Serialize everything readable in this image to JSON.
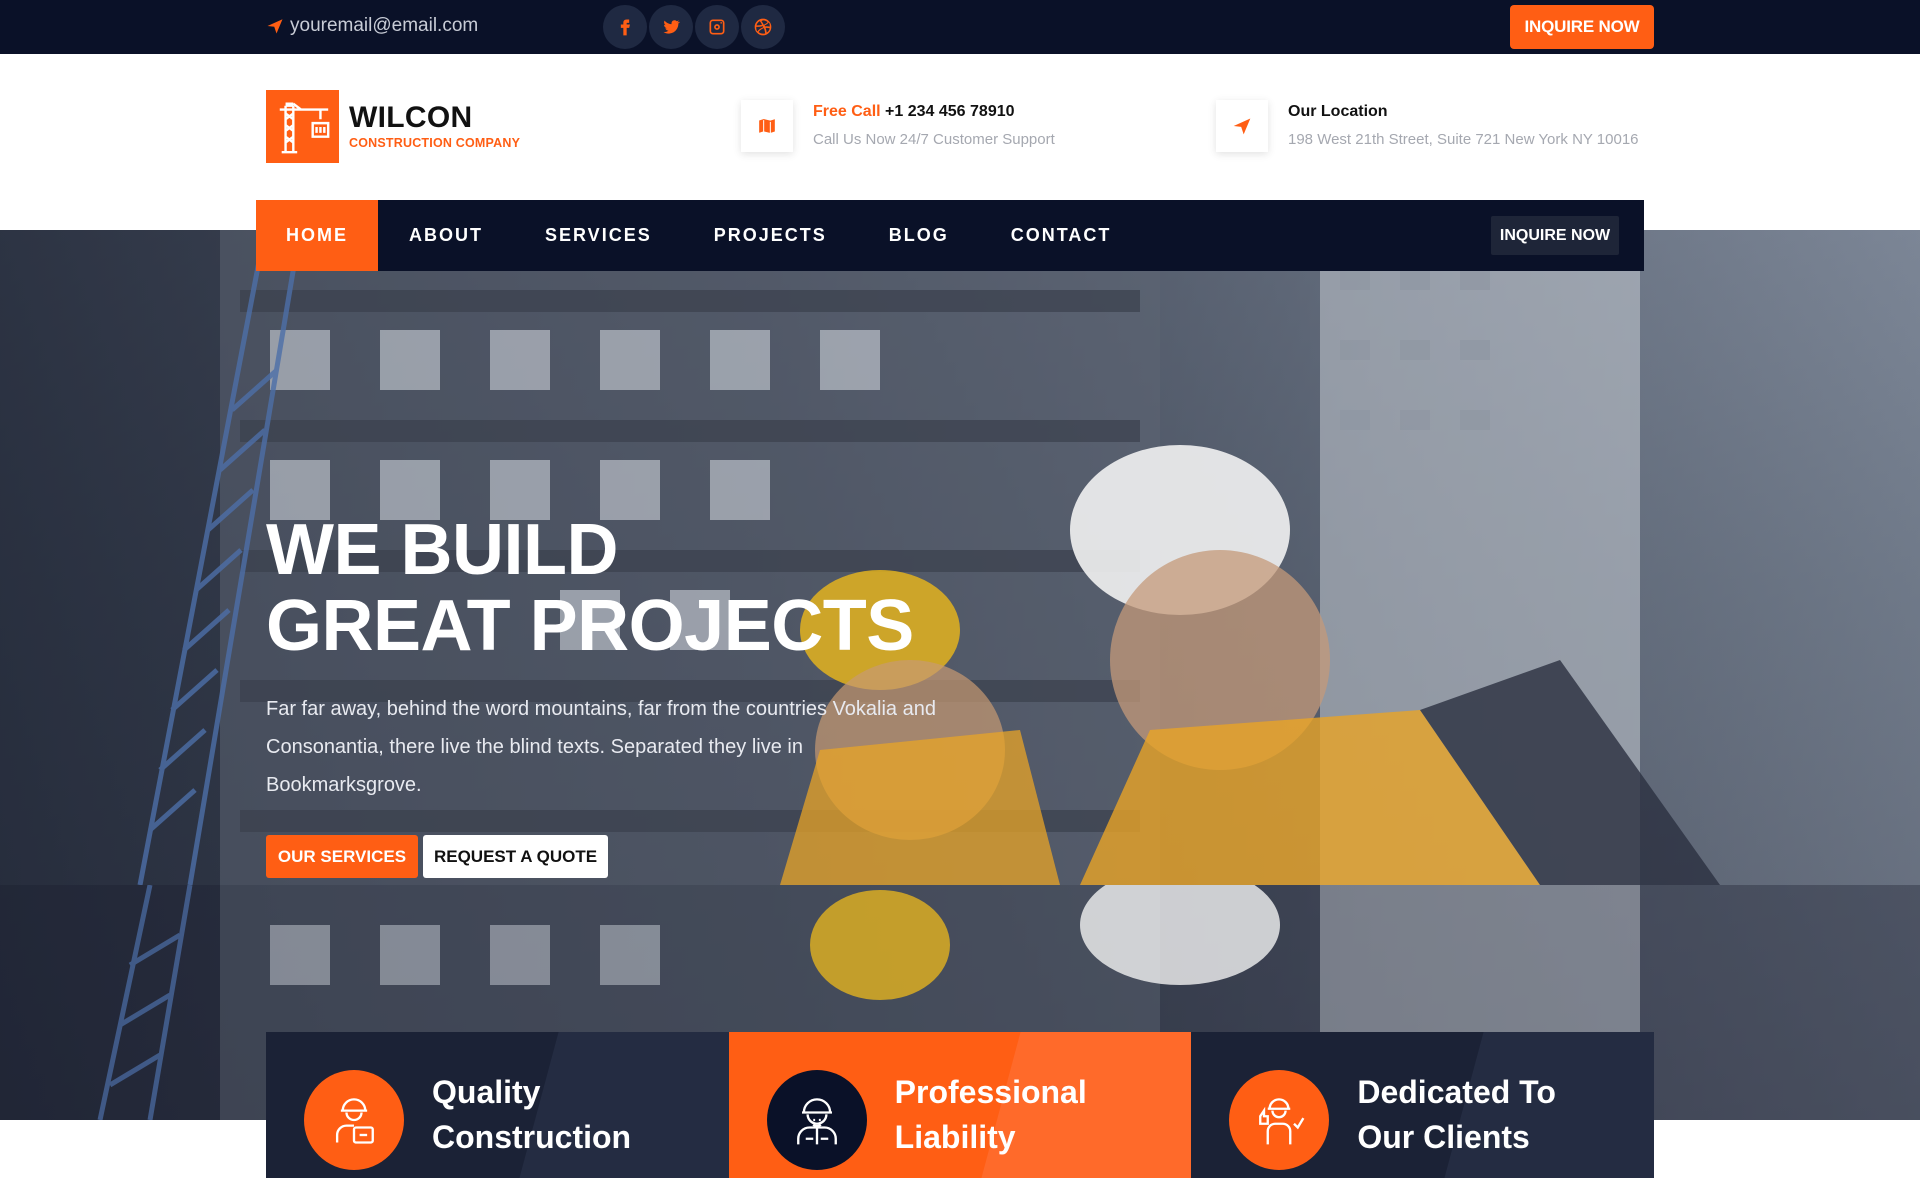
{
  "topbar": {
    "email": "youremail@email.com",
    "socials": [
      "facebook-icon",
      "twitter-icon",
      "instagram-icon",
      "dribbble-icon"
    ],
    "inquire_label": "INQUIRE NOW"
  },
  "brand": {
    "name": "WILCON",
    "tagline": "CONSTRUCTION COMPANY",
    "accent": "#ff5e14",
    "dark": "#0a1128"
  },
  "contact": {
    "call_prefix": "Free Call",
    "call_number": "+1 234 456 78910",
    "call_sub": "Call Us Now 24/7 Customer Support",
    "location_title": "Our Location",
    "location_sub": "198 West 21th Street, Suite 721 New York NY 10016"
  },
  "nav": {
    "items": [
      "HOME",
      "ABOUT",
      "SERVICES",
      "PROJECTS",
      "BLOG",
      "CONTACT"
    ],
    "active": "HOME",
    "inquire_label": "INQUIRE NOW"
  },
  "hero": {
    "title_line1": "WE BUILD",
    "title_line2": "GREAT PROJECTS",
    "text": "Far far away, behind the word mountains, far from the countries Vokalia and Consonantia, there live the blind texts. Separated they live in Bookmarksgrove.",
    "btn_services": "OUR SERVICES",
    "btn_quote": "REQUEST A QUOTE"
  },
  "features": [
    {
      "title": "Quality Construction",
      "icon": "worker-tools-icon"
    },
    {
      "title": "Professional Liability",
      "icon": "worker-helmet-icon"
    },
    {
      "title": "Dedicated To Our Clients",
      "icon": "worker-thumbs-up-icon"
    }
  ]
}
